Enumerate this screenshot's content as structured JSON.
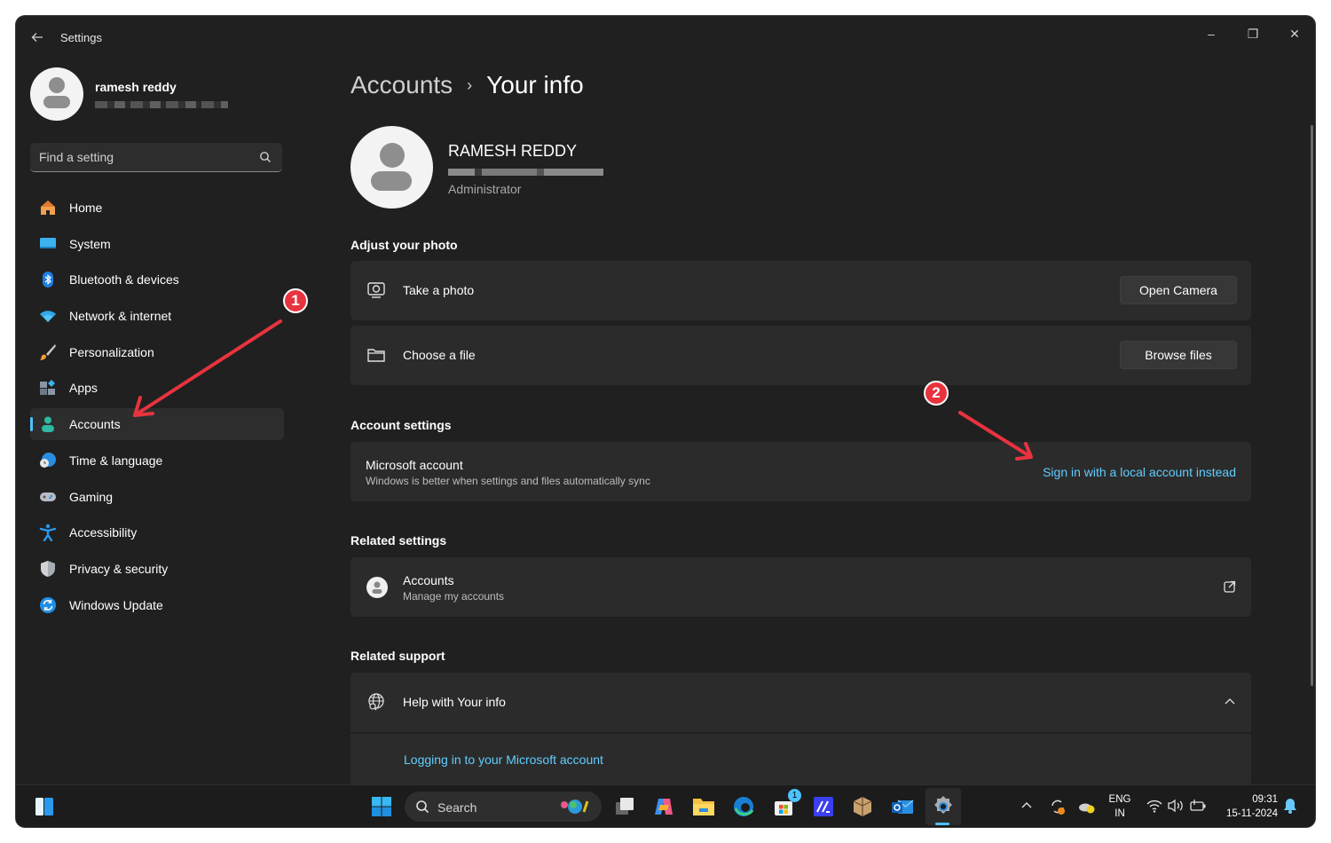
{
  "window": {
    "title": "Settings",
    "controls": {
      "minimize": "–",
      "maximize": "❐",
      "close": "✕"
    }
  },
  "sidebar": {
    "profile": {
      "name": "ramesh reddy",
      "email_redacted": true
    },
    "search": {
      "placeholder": "Find a setting",
      "value": ""
    },
    "items": [
      {
        "label": "Home",
        "icon": "home-icon",
        "active": false
      },
      {
        "label": "System",
        "icon": "monitor-icon",
        "active": false
      },
      {
        "label": "Bluetooth & devices",
        "icon": "bluetooth-icon",
        "active": false
      },
      {
        "label": "Network & internet",
        "icon": "wifi-icon",
        "active": false
      },
      {
        "label": "Personalization",
        "icon": "paintbrush-icon",
        "active": false
      },
      {
        "label": "Apps",
        "icon": "apps-icon",
        "active": false
      },
      {
        "label": "Accounts",
        "icon": "person-icon",
        "active": true
      },
      {
        "label": "Time & language",
        "icon": "globe-clock-icon",
        "active": false
      },
      {
        "label": "Gaming",
        "icon": "gamepad-icon",
        "active": false
      },
      {
        "label": "Accessibility",
        "icon": "accessibility-icon",
        "active": false
      },
      {
        "label": "Privacy & security",
        "icon": "shield-icon",
        "active": false
      },
      {
        "label": "Windows Update",
        "icon": "update-icon",
        "active": false
      }
    ]
  },
  "main": {
    "breadcrumb": {
      "parent": "Accounts",
      "separator": "›",
      "current": "Your info"
    },
    "user": {
      "full_name": "RAMESH REDDY",
      "role": "Administrator",
      "email_redacted": true
    },
    "adjust_photo": {
      "title": "Adjust your photo",
      "rows": [
        {
          "label": "Take a photo",
          "icon": "camera-icon",
          "button": "Open Camera"
        },
        {
          "label": "Choose a file",
          "icon": "folder-icon",
          "button": "Browse files"
        }
      ]
    },
    "account_settings": {
      "title": "Account settings",
      "row": {
        "title": "Microsoft account",
        "subtitle": "Windows is better when settings and files automatically sync",
        "link": "Sign in with a local account instead"
      }
    },
    "related_settings": {
      "title": "Related settings",
      "row": {
        "title": "Accounts",
        "subtitle": "Manage my accounts",
        "icon": "external-link-icon"
      }
    },
    "related_support": {
      "title": "Related support",
      "row": {
        "title": "Help with Your info",
        "expanded": true
      },
      "links": [
        "Logging in to your Microsoft account"
      ]
    }
  },
  "annotations": [
    {
      "number": "1",
      "target": "Accounts nav item"
    },
    {
      "number": "2",
      "target": "Sign in with a local account instead"
    }
  ],
  "taskbar": {
    "search_label": "Search",
    "store_badge": "1",
    "tray": {
      "lang_line1": "ENG",
      "lang_line2": "IN",
      "time": "09:31",
      "date": "15-11-2024"
    }
  },
  "colors": {
    "accent": "#4cc2ff",
    "link": "#60cdff",
    "annotation": "#e8333f",
    "background": "#202020",
    "card": "#2b2b2b"
  }
}
